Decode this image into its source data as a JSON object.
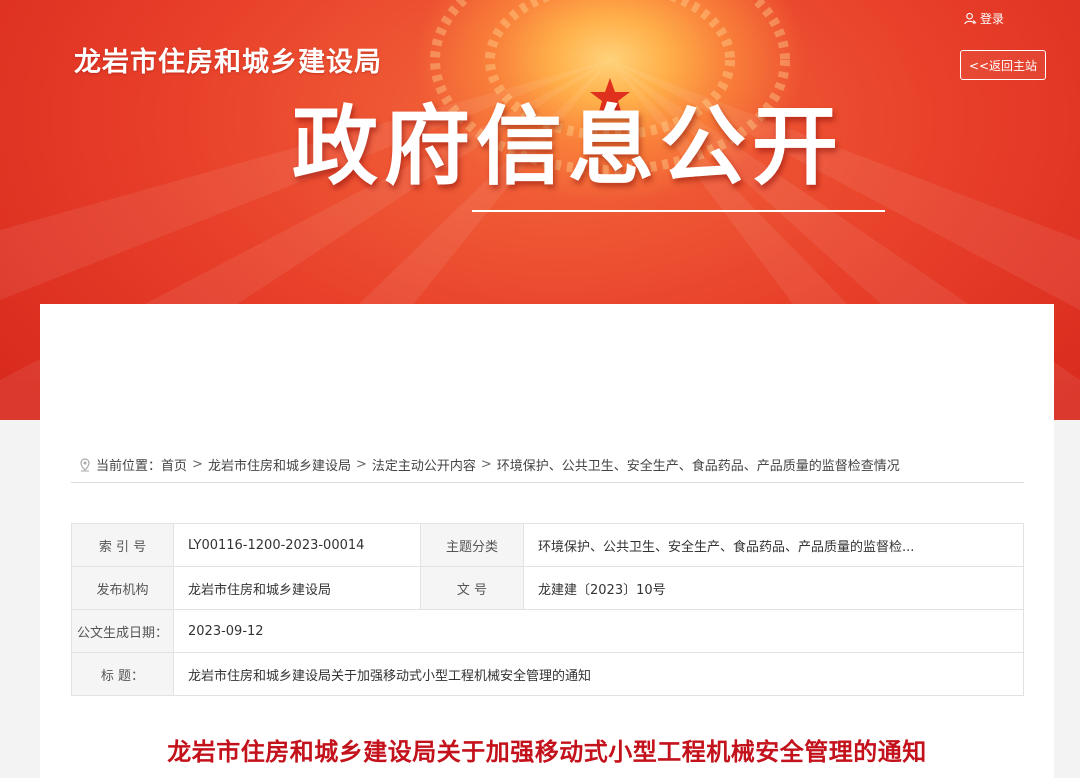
{
  "header": {
    "site_title": "龙岩市住房和城乡建设局",
    "login_label": "登录",
    "back_label": "<<返回主站",
    "big_title": "政府信息公开"
  },
  "breadcrumb": {
    "prefix": "当前位置：",
    "items": [
      "首页",
      "龙岩市住房和城乡建设局",
      "法定主动公开内容",
      "环境保护、公共卫生、安全生产、食品药品、产品质量的监督检查情况"
    ],
    "separator": ">"
  },
  "meta": {
    "index_key": "索 引 号",
    "index_val": "LY00116-1200-2023-00014",
    "topic_key": "主题分类",
    "topic_val": "环境保护、公共卫生、安全生产、食品药品、产品质量的监督检...",
    "org_key": "发布机构",
    "org_val": "龙岩市住房和城乡建设局",
    "docno_key": "文 号",
    "docno_val": "龙建建〔2023〕10号",
    "date_key": "公文生成日期：",
    "date_val": "2023-09-12",
    "title_key": "标 题：",
    "title_val": "龙岩市住房和城乡建设局关于加强移动式小型工程机械安全管理的通知"
  },
  "document": {
    "title": "龙岩市住房和城乡建设局关于加强移动式小型工程机械安全管理的通知"
  },
  "colors": {
    "banner_red": "#e23a25",
    "title_red": "#c4121c",
    "page_bg": "#f3f3f3"
  },
  "icons": {
    "login": "user-icon",
    "breadcrumb": "location-pin-icon",
    "emblem": "star-icon"
  }
}
